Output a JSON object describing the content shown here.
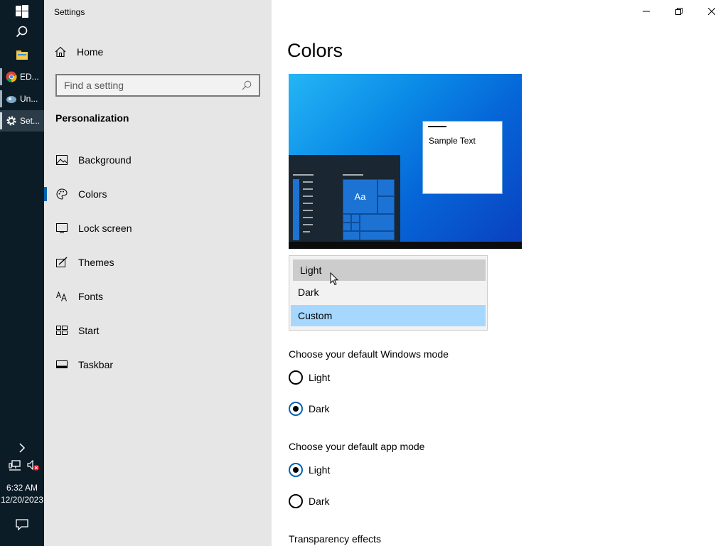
{
  "taskbar": {
    "apps": [
      {
        "label": "ED...",
        "icon": "chrome-icon"
      },
      {
        "label": "Un...",
        "icon": "app-icon"
      },
      {
        "label": "Set...",
        "icon": "gear-icon"
      }
    ],
    "time": "6:32 AM",
    "date": "12/20/2023"
  },
  "window": {
    "title": "Settings"
  },
  "nav": {
    "home_label": "Home",
    "search_placeholder": "Find a setting",
    "section_title": "Personalization",
    "items": [
      {
        "label": "Background",
        "icon": "picture-icon"
      },
      {
        "label": "Colors",
        "icon": "palette-icon"
      },
      {
        "label": "Lock screen",
        "icon": "lock-screen-icon"
      },
      {
        "label": "Themes",
        "icon": "brush-icon"
      },
      {
        "label": "Fonts",
        "icon": "font-icon"
      },
      {
        "label": "Start",
        "icon": "start-icon"
      },
      {
        "label": "Taskbar",
        "icon": "taskbar-icon"
      }
    ],
    "selected": "Colors"
  },
  "main": {
    "title": "Colors",
    "preview": {
      "sample_text": "Sample Text",
      "tile_text": "Aa"
    },
    "color_dropdown": {
      "options": [
        "Light",
        "Dark",
        "Custom"
      ],
      "hovered": "Light",
      "selected": "Custom"
    },
    "windows_mode": {
      "label": "Choose your default Windows mode",
      "options": [
        "Light",
        "Dark"
      ],
      "selected": "Dark"
    },
    "app_mode": {
      "label": "Choose your default app mode",
      "options": [
        "Light",
        "Dark"
      ],
      "selected": "Light"
    },
    "transparency_label": "Transparency effects"
  },
  "colors": {
    "accent": "#0063b1",
    "taskbar_bg": "#0b1c27",
    "nav_bg": "#e6e6e6",
    "dropdown_selected": "#a6d8ff"
  }
}
